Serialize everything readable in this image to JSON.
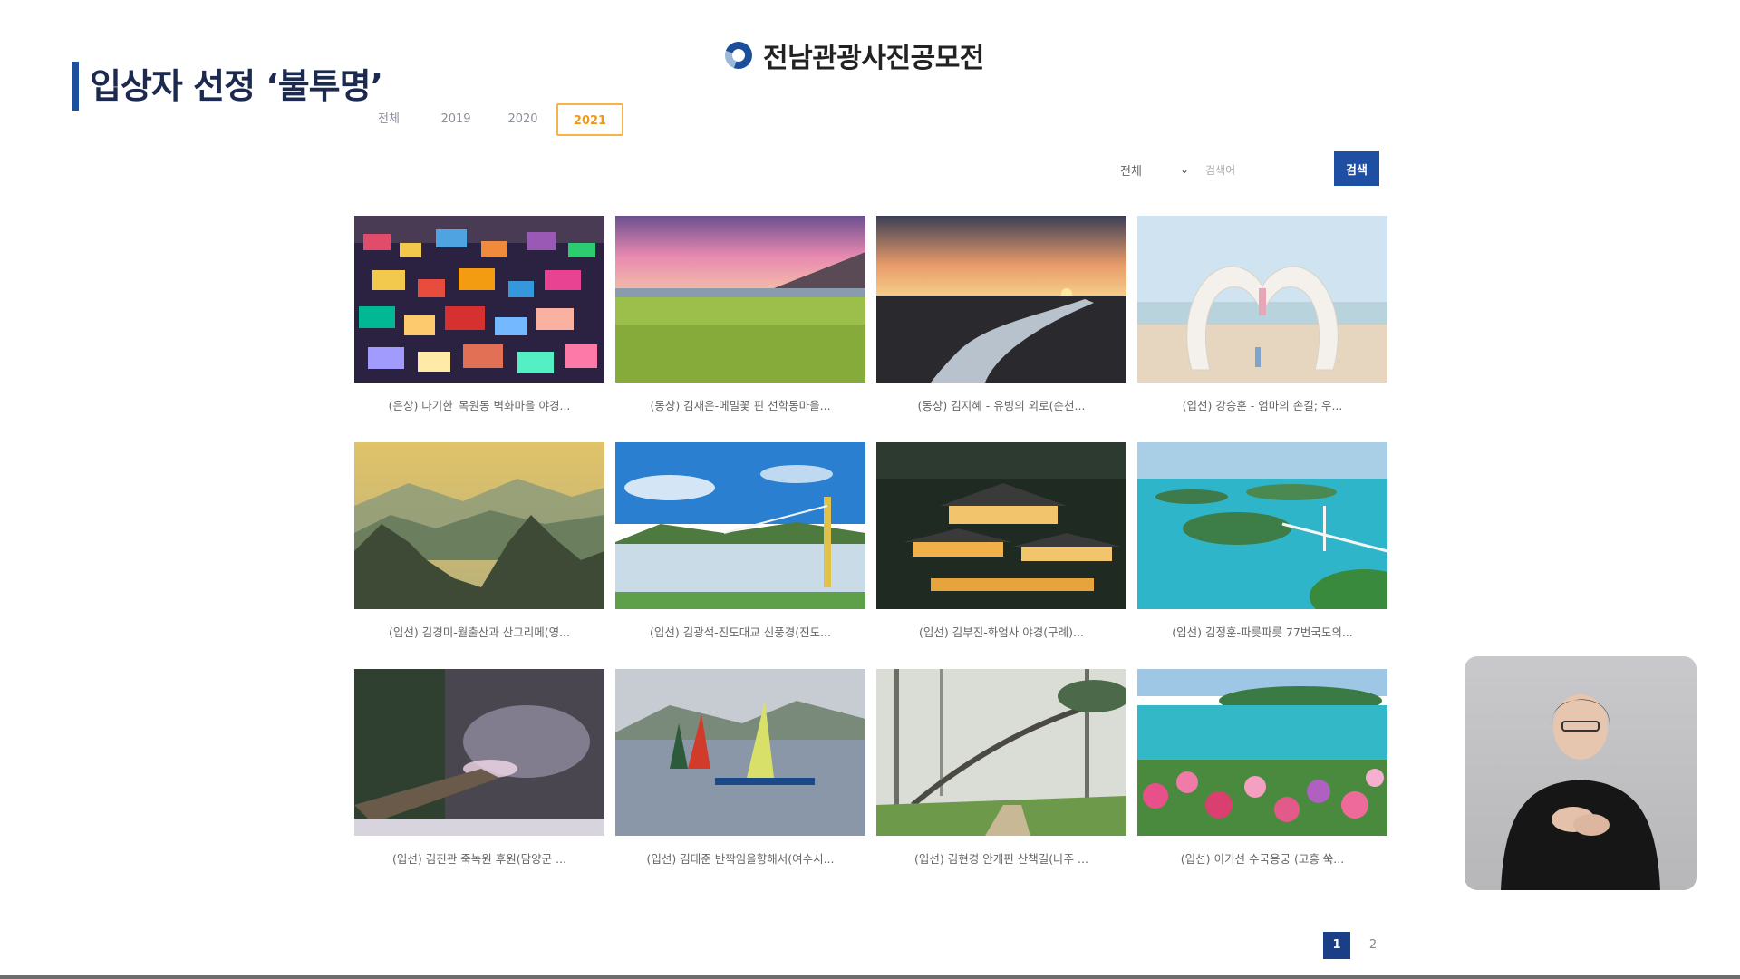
{
  "broadcast_caption": "입상자 선정 ‘불투명’",
  "site": {
    "title": "전남관광사진공모전",
    "logo_icon": "ring-logo-icon",
    "brand_color": "#1b4f9c"
  },
  "tabs": [
    {
      "label": "전체",
      "active": false
    },
    {
      "label": "2019",
      "active": false
    },
    {
      "label": "2020",
      "active": false
    },
    {
      "label": "2021",
      "active": true
    }
  ],
  "search": {
    "select_value": "전체",
    "placeholder": "검색어",
    "button_label": "검색",
    "button_color": "#1f4fa3"
  },
  "gallery": [
    {
      "caption": "(은상) 나기한_목원동 벽화마을 야경...",
      "scene": "city-night"
    },
    {
      "caption": "(동상) 김재은-메밀꽃 핀 선학동마을...",
      "scene": "flower-field"
    },
    {
      "caption": "(동상) 김지혜 - 유빙의 외로(순천...",
      "scene": "sunset-river"
    },
    {
      "caption": "(입선) 강승훈 - 엄마의 손길; 우...",
      "scene": "heart-hands"
    },
    {
      "caption": "(입선) 김경미-월출산과 산그리메(영...",
      "scene": "mountains"
    },
    {
      "caption": "(입선) 김광석-진도대교 신풍경(진도...",
      "scene": "bridge-bay"
    },
    {
      "caption": "(입선) 김부진-화엄사 야경(구례)...",
      "scene": "temple-night"
    },
    {
      "caption": "(입선) 김정훈-파릇파릇 77번국도의...",
      "scene": "islands-bridge"
    },
    {
      "caption": "(입선) 김진관 죽녹원 후원(담양군 ...",
      "scene": "snow-bamboo"
    },
    {
      "caption": "(입선) 김태준 반짝임을향해서(여수시...",
      "scene": "windsurf"
    },
    {
      "caption": "(입선) 김현경 안개핀 산책길(나주 ...",
      "scene": "misty-forest"
    },
    {
      "caption": "(입선) 이기선 수국용궁 (고흥 쑥...",
      "scene": "hydrangea-coast"
    }
  ],
  "pagination": [
    {
      "label": "1",
      "active": true
    },
    {
      "label": "2",
      "active": false
    }
  ],
  "interpreter_label": "sign-language-interpreter"
}
